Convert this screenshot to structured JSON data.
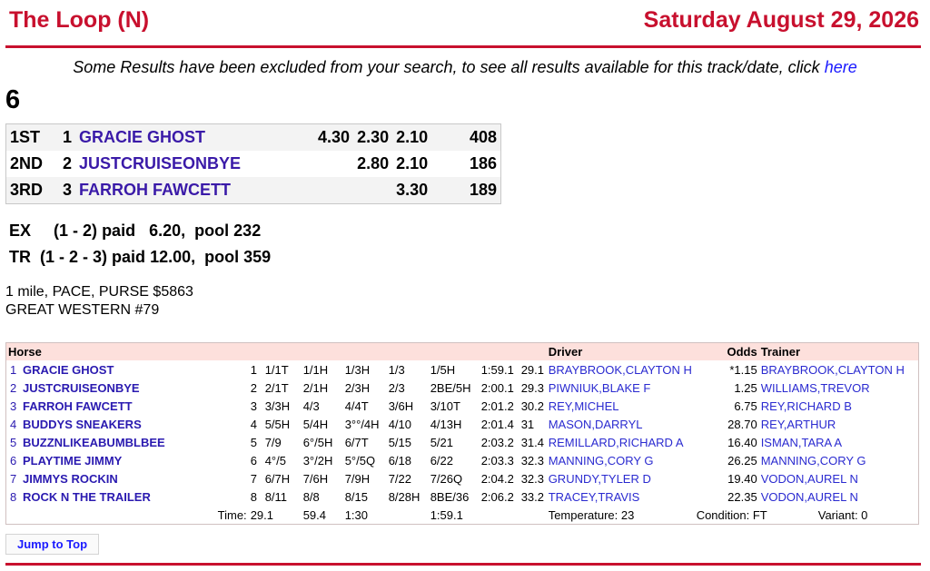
{
  "header": {
    "track": "The Loop (N)",
    "date": "Saturday August 29, 2026"
  },
  "notice": {
    "text": "Some Results have been excluded from your search, to see all results available for this track/date, click ",
    "link": "here"
  },
  "race_number": "6",
  "top3": [
    {
      "place": "1ST",
      "pp": "1",
      "name": "GRACIE GHOST",
      "win": "4.30",
      "place_pay": "2.30",
      "show": "2.10",
      "count": "408"
    },
    {
      "place": "2ND",
      "pp": "2",
      "name": "JUSTCRUISEONBYE",
      "win": "",
      "place_pay": "2.80",
      "show": "2.10",
      "count": "186"
    },
    {
      "place": "3RD",
      "pp": "3",
      "name": "FARROH FAWCETT",
      "win": "",
      "place_pay": "",
      "show": "3.30",
      "count": "189"
    }
  ],
  "wagers": [
    {
      "type": "EX",
      "combo": "(1 - 2)",
      "paid_label": "paid",
      "paid": "6.20,",
      "pool_label": "pool",
      "pool": "232"
    },
    {
      "type": "TR",
      "combo": "(1 - 2 - 3)",
      "paid_label": "paid",
      "paid": "12.00,",
      "pool_label": "pool",
      "pool": "359"
    }
  ],
  "race_info": {
    "line1": "1 mile, PACE, PURSE $5863",
    "line2": "GREAT WESTERN #79"
  },
  "results": {
    "headers": {
      "horse": "Horse",
      "driver": "Driver",
      "odds": "Odds",
      "trainer": "Trainer"
    },
    "rows": [
      {
        "pp": "1",
        "horse": "GRACIE GHOST",
        "post": "1",
        "q1": "1/1T",
        "q2": "1/1H",
        "q3": "1/3H",
        "str": "1/3",
        "fin": "1/5H",
        "time": "1:59.1",
        "last": "29.1",
        "driver": "BRAYBROOK,CLAYTON H",
        "odds": "*1.15",
        "trainer": "BRAYBROOK,CLAYTON H"
      },
      {
        "pp": "2",
        "horse": "JUSTCRUISEONBYE",
        "post": "2",
        "q1": "2/1T",
        "q2": "2/1H",
        "q3": "2/3H",
        "str": "2/3",
        "fin": "2BE/5H",
        "time": "2:00.1",
        "last": "29.3",
        "driver": "PIWNIUK,BLAKE F",
        "odds": "1.25",
        "trainer": "WILLIAMS,TREVOR"
      },
      {
        "pp": "3",
        "horse": "FARROH FAWCETT",
        "post": "3",
        "q1": "3/3H",
        "q2": "4/3",
        "q3": "4/4T",
        "str": "3/6H",
        "fin": "3/10T",
        "time": "2:01.2",
        "last": "30.2",
        "driver": "REY,MICHEL",
        "odds": "6.75",
        "trainer": "REY,RICHARD B"
      },
      {
        "pp": "4",
        "horse": "BUDDYS SNEAKERS",
        "post": "4",
        "q1": "5/5H",
        "q2": "5/4H",
        "q3": "3°°/4H",
        "str": "4/10",
        "fin": "4/13H",
        "time": "2:01.4",
        "last": "31",
        "driver": "MASON,DARRYL",
        "odds": "28.70",
        "trainer": "REY,ARTHUR"
      },
      {
        "pp": "5",
        "horse": "BUZZNLIKEABUMBLBEE",
        "post": "5",
        "q1": "7/9",
        "q2": "6°/5H",
        "q3": "6/7T",
        "str": "5/15",
        "fin": "5/21",
        "time": "2:03.2",
        "last": "31.4",
        "driver": "REMILLARD,RICHARD A",
        "odds": "16.40",
        "trainer": "ISMAN,TARA A"
      },
      {
        "pp": "6",
        "horse": "PLAYTIME JIMMY",
        "post": "6",
        "q1": "4°/5",
        "q2": "3°/2H",
        "q3": "5°/5Q",
        "str": "6/18",
        "fin": "6/22",
        "time": "2:03.3",
        "last": "32.3",
        "driver": "MANNING,CORY G",
        "odds": "26.25",
        "trainer": "MANNING,CORY G"
      },
      {
        "pp": "7",
        "horse": "JIMMYS ROCKIN",
        "post": "7",
        "q1": "6/7H",
        "q2": "7/6H",
        "q3": "7/9H",
        "str": "7/22",
        "fin": "7/26Q",
        "time": "2:04.2",
        "last": "32.3",
        "driver": "GRUNDY,TYLER D",
        "odds": "19.40",
        "trainer": "VODON,AUREL N"
      },
      {
        "pp": "8",
        "horse": "ROCK N THE TRAILER",
        "post": "8",
        "q1": "8/11",
        "q2": "8/8",
        "q3": "8/15",
        "str": "8/28H",
        "fin": "8BE/36",
        "time": "2:06.2",
        "last": "33.2",
        "driver": "TRACEY,TRAVIS",
        "odds": "22.35",
        "trainer": "VODON,AUREL N"
      }
    ],
    "time_row": {
      "label": "Time:",
      "t1": "29.1",
      "t2": "59.4",
      "t3": "1:30",
      "t4": "1:59.1",
      "temperature": "Temperature: 23",
      "condition": "Condition: FT",
      "variant": "Variant: 0"
    }
  },
  "jump_label": "Jump to Top",
  "colors": {
    "accent": "#c8102e",
    "link": "#1a1aff",
    "horse": "#3a1aa8"
  }
}
